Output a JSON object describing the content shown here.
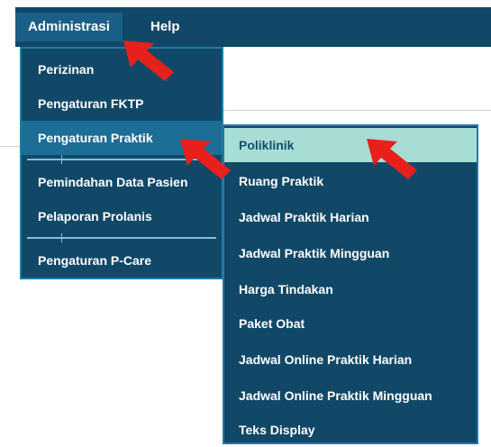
{
  "menubar": {
    "tabs": [
      {
        "label": "Administrasi"
      },
      {
        "label": "Help"
      }
    ]
  },
  "admin_menu": {
    "items": [
      {
        "label": "Perizinan"
      },
      {
        "label": "Pengaturan FKTP"
      },
      {
        "label": "Pengaturan Praktik"
      },
      {
        "label": "Pemindahan Data Pasien"
      },
      {
        "label": "Pelaporan Prolanis"
      },
      {
        "label": "Pengaturan P-Care"
      }
    ]
  },
  "praktik_submenu": {
    "items": [
      {
        "label": "Poliklinik"
      },
      {
        "label": "Ruang Praktik"
      },
      {
        "label": "Jadwal Praktik Harian"
      },
      {
        "label": "Jadwal Praktik Mingguan"
      },
      {
        "label": "Harga Tindakan"
      },
      {
        "label": "Paket Obat"
      },
      {
        "label": "Jadwal Online Praktik Harian"
      },
      {
        "label": "Jadwal Online Praktik Mingguan"
      },
      {
        "label": "Teks Display"
      }
    ]
  },
  "colors": {
    "menu_bg": "#114867",
    "highlight_main": "#1d6e96",
    "highlight_sub": "#a7ddd5",
    "annotation_arrow": "#e8201c"
  }
}
